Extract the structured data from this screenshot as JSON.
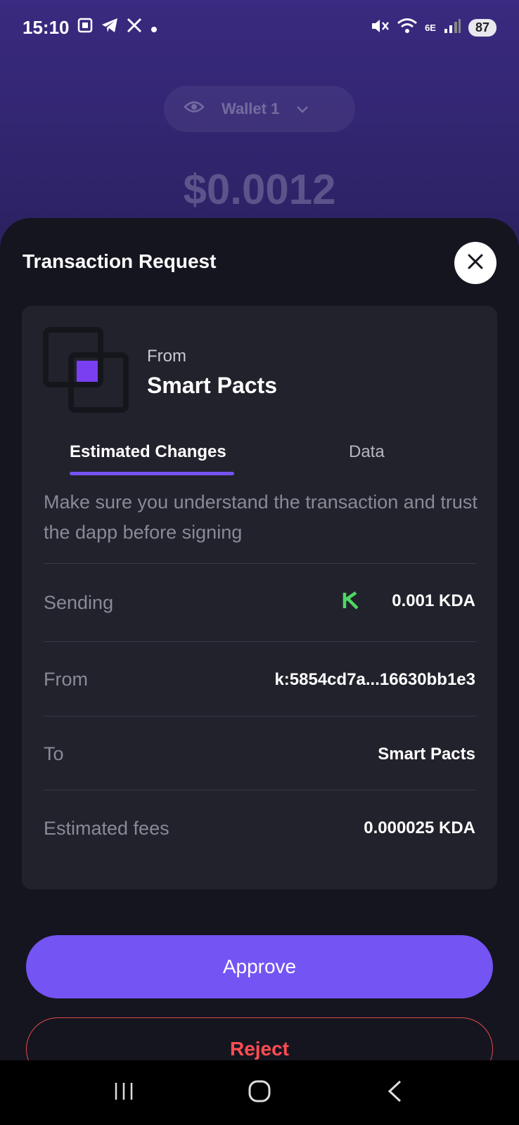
{
  "status_bar": {
    "time": "15:10",
    "battery": "87",
    "net": "6E"
  },
  "background": {
    "wallet_name": "Wallet 1",
    "balance": "$0.0012"
  },
  "sheet": {
    "title": "Transaction Request",
    "from_label": "From",
    "dapp_name": "Smart Pacts",
    "tabs": [
      {
        "label": "Estimated Changes",
        "active": true
      },
      {
        "label": "Data",
        "active": false
      }
    ],
    "notice": "Make sure you understand the transaction and trust the dapp before signing",
    "rows": [
      {
        "label": "Sending",
        "value": "0.001 KDA",
        "icon": "kda-logo-icon"
      },
      {
        "label": "From",
        "value": "k:5854cd7a...16630bb1e3"
      },
      {
        "label": "To",
        "value": "Smart Pacts"
      },
      {
        "label": "Estimated fees",
        "value": "0.000025 KDA"
      }
    ],
    "approve_label": "Approve",
    "reject_label": "Reject"
  },
  "colors": {
    "accent": "#7554f4",
    "reject": "#ff4d52",
    "kda": "#4cd964"
  }
}
